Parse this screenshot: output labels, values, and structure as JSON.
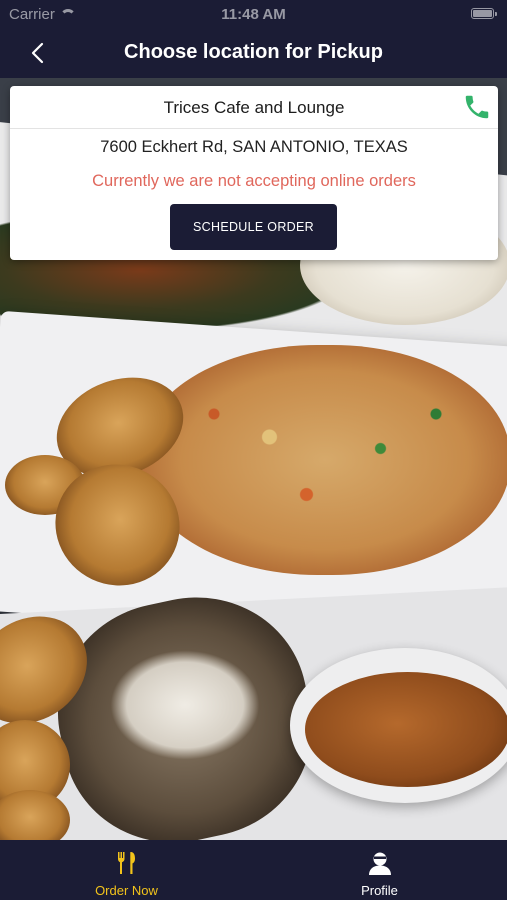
{
  "status_bar": {
    "carrier": "Carrier",
    "time": "11:48 AM"
  },
  "nav": {
    "title": "Choose location for Pickup"
  },
  "location_card": {
    "name": "Trices Cafe and Lounge",
    "address": "7600 Eckhert Rd, SAN ANTONIO, TEXAS",
    "notice": "Currently we are not accepting online orders",
    "schedule_button": "SCHEDULE ORDER"
  },
  "tabs": [
    {
      "label": "Order Now",
      "icon": "fork-knife-icon",
      "active": true
    },
    {
      "label": "Profile",
      "icon": "user-icon",
      "active": false
    }
  ],
  "colors": {
    "primary_navy": "#1b1c35",
    "active_tab": "#f2c31b",
    "notice_red": "#e0675c",
    "phone_green": "#33b36b"
  }
}
